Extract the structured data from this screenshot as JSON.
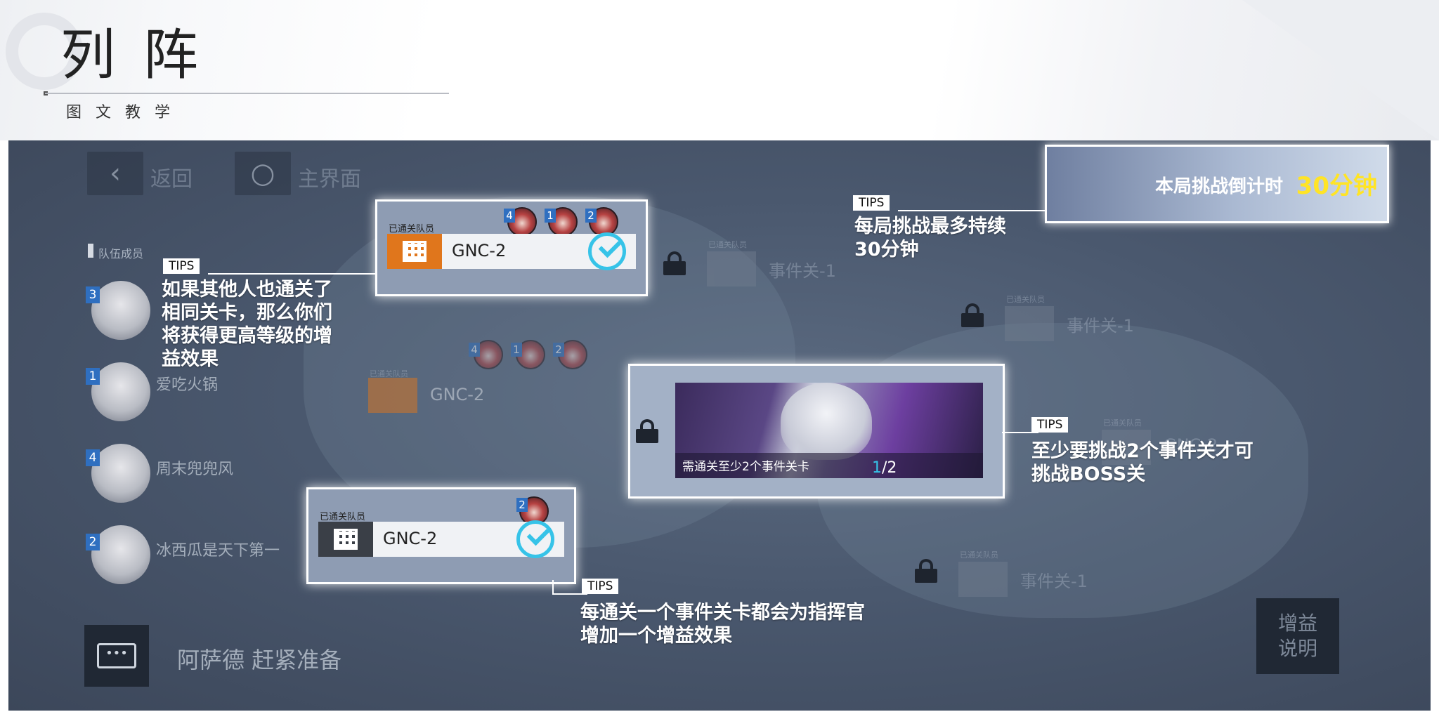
{
  "header": {
    "title": "列阵",
    "subtitle": "图文教学"
  },
  "game": {
    "back_label": "返回",
    "home_label": "主界面",
    "team_header": "队伍成员",
    "members": [
      {
        "badge": "3",
        "name": ""
      },
      {
        "badge": "1",
        "name": "爱吃火锅"
      },
      {
        "badge": "4",
        "name": "周末兜兜风"
      },
      {
        "badge": "2",
        "name": "冰西瓜是天下第一"
      }
    ],
    "chat_text": "阿萨德 赶紧准备",
    "buff_button": [
      "增益",
      "说明"
    ],
    "event_node_label": "事件关-1",
    "gnc_label": "GNC-2",
    "cleared_caption": "已通关队员",
    "boss": {
      "requirement": "需通关至少2个事件关卡",
      "progress_current": "1",
      "progress_total": "/2"
    },
    "timer": {
      "label": "本局挑战倒计时",
      "value": "30分钟"
    }
  },
  "cards": {
    "card1_badges": [
      "4",
      "1",
      "2"
    ],
    "card2_badges": [
      "4",
      "1",
      "2"
    ],
    "card3_badges": [
      "2"
    ]
  },
  "tips": {
    "tag": "TIPS",
    "same_stage": [
      "如果其他人也通关了",
      "相同关卡，那么你们",
      "将获得更高等级的增",
      "益效果"
    ],
    "duration": [
      "每局挑战最多持续",
      "30分钟"
    ],
    "boss": [
      "至少要挑战2个事件关才可",
      "挑战BOSS关"
    ],
    "buff": [
      "每通关一个事件关卡都会为指挥官",
      "增加一个增益效果"
    ]
  },
  "colors": {
    "accent_cyan": "#36c3e8",
    "timer_yellow": "#ffe426",
    "orange_icon": "#e0761c"
  }
}
